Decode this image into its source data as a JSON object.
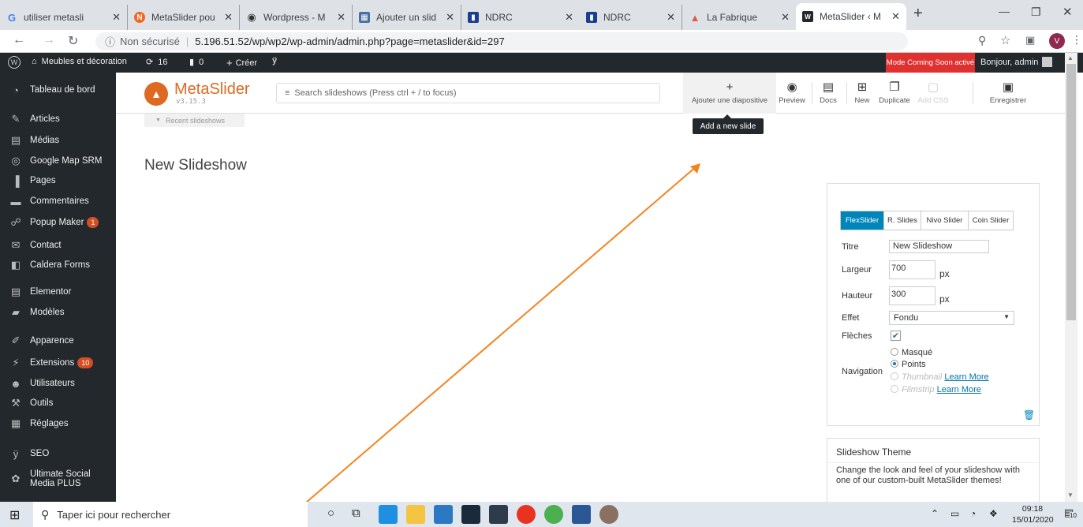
{
  "browser": {
    "tabs": [
      {
        "label": "utiliser metasli",
        "icon": "google-icon"
      },
      {
        "label": "MetaSlider pou",
        "icon": "metaslider-icon"
      },
      {
        "label": "Wordpress - M",
        "icon": "globe-icon"
      },
      {
        "label": "Ajouter un slid",
        "icon": "image-icon"
      },
      {
        "label": "NDRC",
        "icon": "ndrc-icon"
      },
      {
        "label": "NDRC",
        "icon": "ndrc-icon"
      },
      {
        "label": "La Fabrique",
        "icon": "fabrique-icon"
      },
      {
        "label": "MetaSlider ‹ M",
        "icon": "wp-icon"
      }
    ],
    "security": "Non sécurisé",
    "url": "5.196.51.52/wp/wp2/wp-admin/admin.php?page=metaslider&id=297",
    "avatar_letter": "V"
  },
  "adminbar": {
    "site": "Meubles et décoration",
    "updates": "16",
    "comments": "0",
    "create": "Créer",
    "coming_soon": "Mode Coming Soon activé",
    "greeting": "Bonjour, admin"
  },
  "sidebar": {
    "items": [
      {
        "label": "Tableau de bord",
        "icon": "dashboard-icon"
      },
      {
        "label": "Articles",
        "icon": "pin-icon"
      },
      {
        "label": "Médias",
        "icon": "media-icon"
      },
      {
        "label": "Google Map SRM",
        "icon": "map-pin-icon"
      },
      {
        "label": "Pages",
        "icon": "pages-icon"
      },
      {
        "label": "Commentaires",
        "icon": "comment-icon"
      },
      {
        "label": "Popup Maker",
        "icon": "popup-icon",
        "badge": "1"
      },
      {
        "label": "Contact",
        "icon": "mail-icon"
      },
      {
        "label": "Caldera Forms",
        "icon": "form-icon"
      },
      {
        "label": "Elementor",
        "icon": "elementor-icon"
      },
      {
        "label": "Modèles",
        "icon": "folder-icon"
      },
      {
        "label": "Apparence",
        "icon": "brush-icon"
      },
      {
        "label": "Extensions",
        "icon": "plugin-icon",
        "badge": "10"
      },
      {
        "label": "Utilisateurs",
        "icon": "users-icon"
      },
      {
        "label": "Outils",
        "icon": "wrench-icon"
      },
      {
        "label": "Réglages",
        "icon": "settings-icon"
      },
      {
        "label": "SEO",
        "icon": "yoast-icon"
      },
      {
        "label": "Ultimate Social Media PLUS",
        "icon": "social-icon"
      }
    ]
  },
  "metaslider": {
    "logo": "MetaSlider",
    "version": "v3.15.3",
    "search_placeholder": "Search slideshows (Press ctrl + / to focus)",
    "recent": "Recent slideshows",
    "toolbar": {
      "add_slide": "Ajouter une diapositive",
      "preview": "Preview",
      "docs": "Docs",
      "new": "New",
      "duplicate": "Duplicate",
      "add_css": "Add CSS",
      "save": "Enregistrer"
    },
    "tooltip": "Add a new slide",
    "slideshow_title": "New Slideshow",
    "settings": {
      "slider_types": [
        "FlexSlider",
        "R. Slides",
        "Nivo Slider",
        "Coin Slider"
      ],
      "title_label": "Titre",
      "title_value": "New Slideshow",
      "width_label": "Largeur",
      "width_value": "700",
      "height_label": "Hauteur",
      "height_value": "300",
      "unit": "px",
      "effect_label": "Effet",
      "effect_value": "Fondu",
      "arrows_label": "Flèches",
      "navigation_label": "Navigation",
      "nav_hidden": "Masqué",
      "nav_dots": "Points",
      "nav_thumbnail": "Thumbnail",
      "nav_filmstrip": "Filmstrip",
      "learn_more": "Learn More"
    },
    "theme": {
      "title": "Slideshow Theme",
      "text": "Change the look and feel of your slideshow with one of our custom-built MetaSlider themes!"
    }
  },
  "taskbar": {
    "search_placeholder": "Taper ici pour rechercher",
    "time": "09:18",
    "date": "15/01/2020",
    "notifications": "10"
  },
  "colors": {
    "accent": "#0085ba",
    "metaslider_orange": "#dd6923",
    "wp_dark": "#23282d",
    "coming_soon_red": "#e03131"
  }
}
